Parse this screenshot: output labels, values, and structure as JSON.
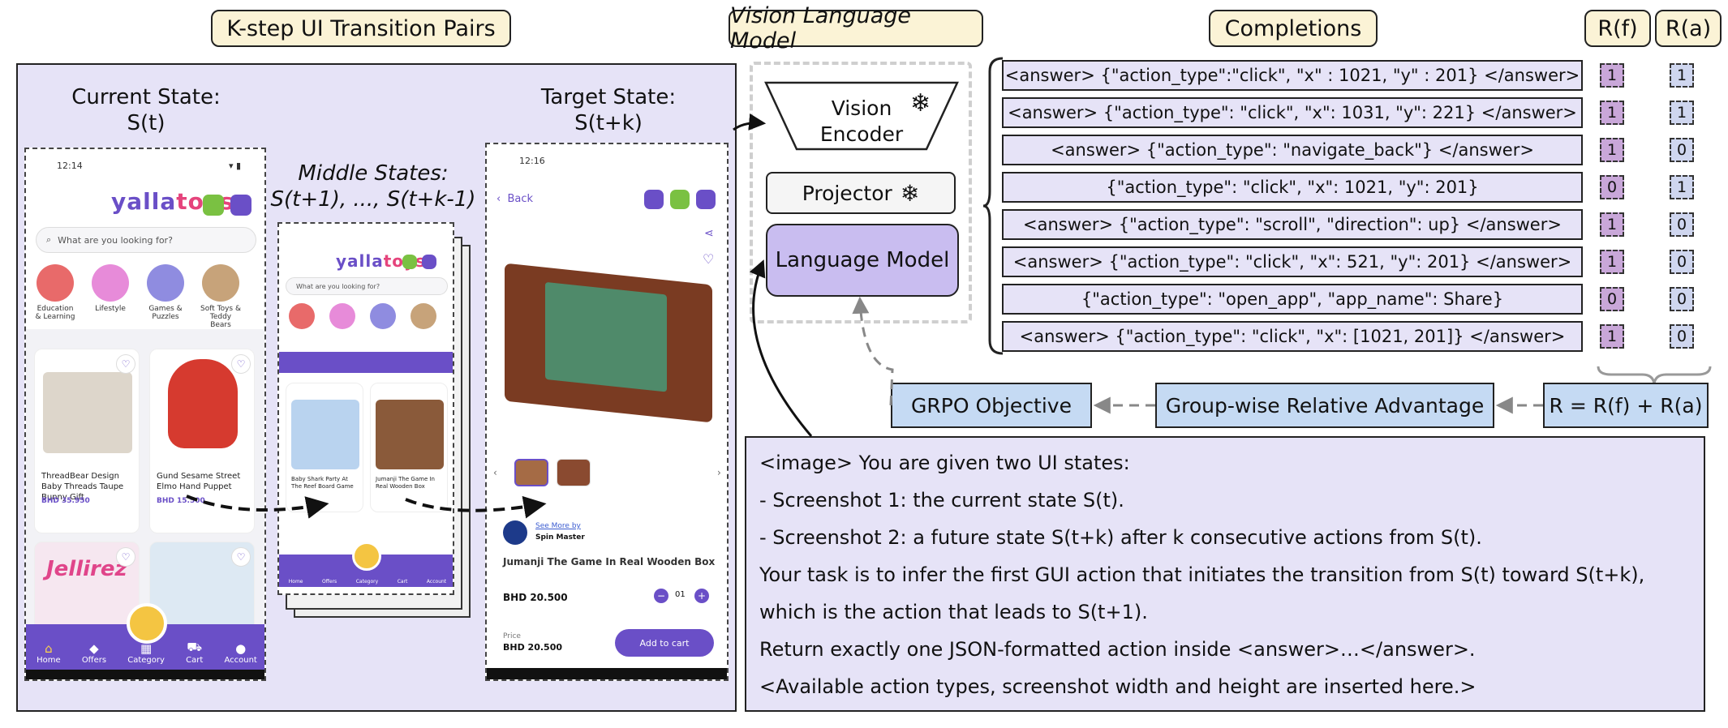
{
  "headers": {
    "pairs": "K-step UI Transition Pairs",
    "vlm": "Vision Language Model",
    "completions": "Completions",
    "rf": "R(f)",
    "ra": "R(a)"
  },
  "states": {
    "current_l1": "Current State:",
    "current_l2": "S(t)",
    "middle_l1": "Middle States:",
    "middle_l2": "S(t+1), ..., S(t+k-1)",
    "target_l1": "Target State:",
    "target_l2": "S(t+k)"
  },
  "phone_current": {
    "time": "12:14",
    "logo_a": "yalla",
    "logo_b": "toys",
    "search_placeholder": "What are you looking for?",
    "categories": [
      "Education & Learning",
      "Lifestyle",
      "Games & Puzzles",
      "Soft Toys & Teddy Bears"
    ],
    "products": [
      {
        "title": "ThreadBear Design Baby Threads Taupe Bunny Gift",
        "price": "BHD 35.950"
      },
      {
        "title": "Gund Sesame Street Elmo Hand Puppet",
        "price": "BHD 15.500"
      }
    ],
    "promo": "Jellirez",
    "nav": [
      "Home",
      "Offers",
      "Category",
      "Cart",
      "Account"
    ]
  },
  "phone_middle": {
    "products": [
      {
        "title": "Baby Shark Party At The Reef Board Game"
      },
      {
        "title": "Jumanji The Game In Real Wooden Box"
      }
    ],
    "nav": [
      "Home",
      "Offers",
      "Category",
      "Cart",
      "Account"
    ]
  },
  "phone_target": {
    "time": "12:16",
    "back": "Back",
    "see_more": "See More by",
    "brand": "Spin Master",
    "title": "Jumanji The Game In Real Wooden Box",
    "price": "BHD 20.500",
    "qty": "01",
    "price_label": "Price",
    "price_bottom": "BHD 20.500",
    "cart_button": "Add to cart"
  },
  "model": {
    "vision_encoder_l1": "Vision",
    "vision_encoder_l2": "Encoder",
    "projector": "Projector",
    "language_model": "Language Model"
  },
  "completions": [
    {
      "text": "<answer> {\"action_type\":\"click\", \"x\" : 1021, \"y\" : 201} </answer>",
      "rf": 1,
      "ra": 1
    },
    {
      "text": "<answer> {\"action_type\": \"click\", \"x\": 1031, \"y\": 221} </answer>",
      "rf": 1,
      "ra": 1
    },
    {
      "text": "<answer> {\"action_type\": \"navigate_back\"} </answer>",
      "rf": 1,
      "ra": 0
    },
    {
      "text": "{\"action_type\": \"click\", \"x\": 1021, \"y\": 201}",
      "rf": 0,
      "ra": 1
    },
    {
      "text": "<answer> {\"action_type\": \"scroll\", \"direction\": up} </answer>",
      "rf": 1,
      "ra": 0
    },
    {
      "text": "<answer> {\"action_type\": \"click\", \"x\": 521, \"y\": 201} </answer>",
      "rf": 1,
      "ra": 0
    },
    {
      "text": "{\"action_type\": \"open_app\", \"app_name\": Share}",
      "rf": 0,
      "ra": 0
    },
    {
      "text": "<answer> {\"action_type\": \"click\", \"x\": [1021, 201]} </answer>",
      "rf": 1,
      "ra": 0
    }
  ],
  "flow": {
    "grpo": "GRPO Objective",
    "advantage": "Group-wise Relative Advantage",
    "reward": "R = R(f) + R(a)"
  },
  "prompt": [
    "<image> You are given two UI states:",
    "-    Screenshot 1: the current state S(t).",
    "-    Screenshot 2: a future state S(t+k) after k consecutive actions from S(t).",
    "Your task is to infer the first GUI action that initiates the transition from S(t) toward S(t+k),",
    "which is the action that leads to S(t+1).",
    "Return exactly one JSON-formatted action inside <answer>…</answer>.",
    "<Available action types, screenshot width and height are inserted here.>"
  ],
  "colors": {
    "panel": "#e6e3f7",
    "header": "#fbf3d6",
    "lm": "#c9bdf0",
    "flow": "#c5daf3",
    "accent": "#6a4fc7",
    "cube_rf": "#c9a7d9",
    "cube_ra": "#cfd6ef"
  }
}
